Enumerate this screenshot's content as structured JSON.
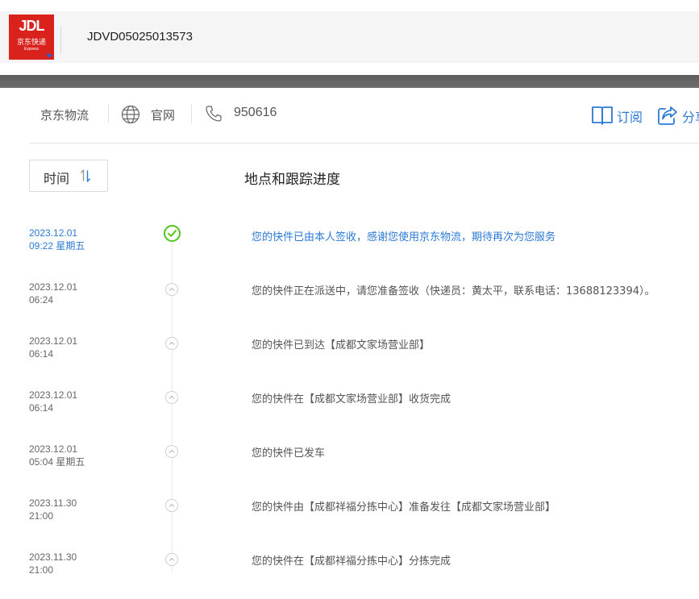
{
  "header": {
    "logo_text": "JDL",
    "logo_cn": "京东快递",
    "logo_en": "Express",
    "tracking_number": "JDVD05025013573"
  },
  "carrier_bar": {
    "carrier_name": "京东物流",
    "website_label": "官网",
    "phone": "950616",
    "subscribe_label": "订阅",
    "share_label": "分享"
  },
  "table": {
    "sort_label": "时间",
    "column_title": "地点和跟踪进度"
  },
  "events": [
    {
      "date": "2023.12.01",
      "time": "09:22 星期五",
      "desc": "您的快件已由本人签收，感谢您使用京东物流，期待再次为您服务",
      "active": true
    },
    {
      "date": "2023.12.01",
      "time": "06:24",
      "desc": "您的快件正在派送中，请您准备签收（快递员：黄太平，联系电话：13688123394）。",
      "active": false
    },
    {
      "date": "2023.12.01",
      "time": "06:14",
      "desc": "您的快件已到达【成都文家场营业部】",
      "active": false
    },
    {
      "date": "2023.12.01",
      "time": "06:14",
      "desc": "您的快件在【成都文家场营业部】收货完成",
      "active": false
    },
    {
      "date": "2023.12.01",
      "time": "05:04 星期五",
      "desc": "您的快件已发车",
      "active": false
    },
    {
      "date": "2023.11.30",
      "time": "21:00",
      "desc": "您的快件由【成都祥福分拣中心】准备发往【成都文家场营业部】",
      "active": false
    },
    {
      "date": "2023.11.30",
      "time": "21:00",
      "desc": "您的快件在【成都祥福分拣中心】分拣完成",
      "active": false
    }
  ],
  "colors": {
    "brand_red": "#d9221c",
    "link_blue": "#2b7ad6",
    "success_green": "#52c41a"
  }
}
